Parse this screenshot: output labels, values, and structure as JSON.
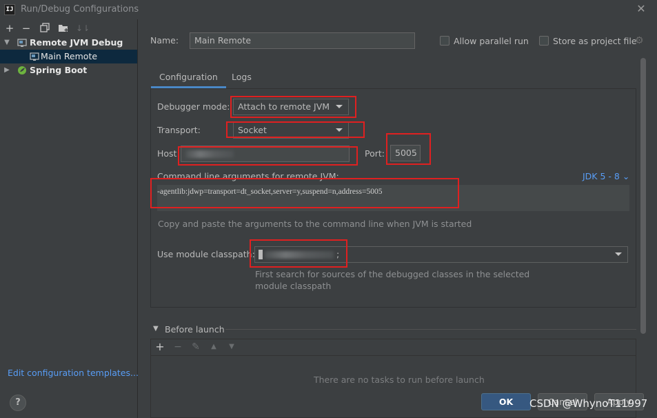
{
  "window": {
    "title": "Run/Debug Configurations",
    "app_icon_text": "IJ"
  },
  "left_toolbar": {
    "icons": [
      "plus-icon",
      "minus-icon",
      "copy-icon",
      "folder-add-icon",
      "sort-icon"
    ]
  },
  "tree": {
    "items": [
      {
        "label": "Remote JVM Debug",
        "expanded": true,
        "bold": true
      },
      {
        "label": "Main Remote",
        "selected": true
      },
      {
        "label": "Spring Boot",
        "expanded": false,
        "bold": true
      }
    ]
  },
  "edit_templates_link": "Edit configuration templates...",
  "help_label": "?",
  "name_field": {
    "label": "Name:",
    "value": "Main Remote"
  },
  "options": {
    "allow_parallel": {
      "label": "Allow parallel run",
      "checked": false
    },
    "store_project": {
      "label": "Store as project file",
      "checked": false
    }
  },
  "tabs": [
    {
      "label": "Configuration",
      "active": true
    },
    {
      "label": "Logs",
      "active": false
    }
  ],
  "configuration": {
    "debugger_mode_label": "Debugger mode:",
    "debugger_mode_value": "Attach to remote JVM",
    "transport_label": "Transport:",
    "transport_value": "Socket",
    "host_label": "Host:",
    "host_value_suffix": "",
    "port_label": "Port:",
    "port_value": "5005",
    "cmd_label": "Command line arguments for remote JVM:",
    "jdk_link": "JDK 5 - 8",
    "cmd_value": "-agentlib:jdwp=transport=dt_socket,server=y,suspend=n,address=5005",
    "cmd_hint": "Copy and paste the arguments to the command line when JVM is started",
    "module_label": "Use module classpath:",
    "module_value_suffix": ";",
    "module_hint_line1": "First search for sources of the debugged classes in the selected",
    "module_hint_line2": "module classpath"
  },
  "before_launch": {
    "label": "Before launch",
    "empty_text": "There are no tasks to run before launch"
  },
  "buttons": {
    "ok": "OK",
    "cancel": "Cancel",
    "apply": "Apply"
  },
  "watermark": "CSDN @WhynoT11997",
  "colors": {
    "accent": "#4a88c7",
    "link": "#589df6",
    "highlight_box": "#e02020",
    "selection": "#0d293e"
  }
}
